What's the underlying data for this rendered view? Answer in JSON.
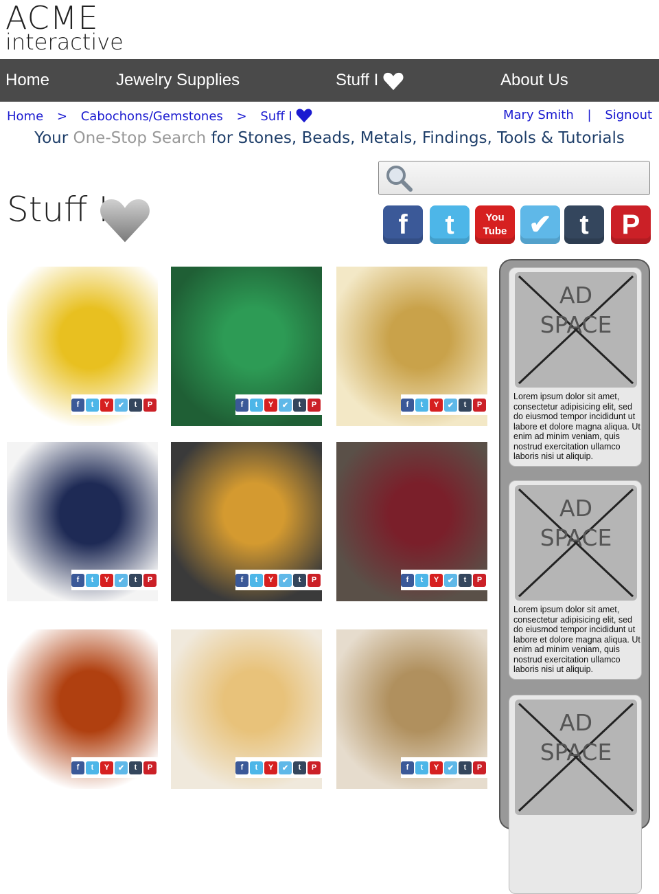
{
  "logo": {
    "line1": "ACME",
    "line2": "interactive"
  },
  "nav": {
    "home": "Home",
    "jewelry": "Jewelry Supplies",
    "stuff": "Stuff I",
    "about": "About Us"
  },
  "breadcrumb": {
    "home": "Home",
    "sep1": ">",
    "category": "Cabochons/Gemstones",
    "sep2": ">",
    "current": "Suff I"
  },
  "user": {
    "name": "Mary Smith",
    "sep": "|",
    "signout": "Signout"
  },
  "tagline": {
    "part1": "Your ",
    "part2": "One-Stop Search",
    "part3": " for Stones, Beads, Metals, Findings, Tools & Tutorials"
  },
  "search": {
    "value": "",
    "placeholder": ""
  },
  "page_title": "Stuff I",
  "social": [
    {
      "name": "facebook-icon",
      "glyph": "f",
      "color": "#3b5998"
    },
    {
      "name": "twitter-icon",
      "glyph": "t",
      "color": "#4db6e8"
    },
    {
      "name": "youtube-icon",
      "glyph": "You Tube",
      "color": "#d62020"
    },
    {
      "name": "foursquare-icon",
      "glyph": "✔",
      "color": "#5fb8e8"
    },
    {
      "name": "tumblr-icon",
      "glyph": "t",
      "color": "#34465d"
    },
    {
      "name": "pinterest-icon",
      "glyph": "P",
      "color": "#cb2027"
    }
  ],
  "tiles": [
    {
      "name": "yellow-gemstones",
      "colors": [
        "#ffffff",
        "#e8c020"
      ]
    },
    {
      "name": "malachite-beads",
      "colors": [
        "#1f5f35",
        "#2d9b55"
      ]
    },
    {
      "name": "gold-wire",
      "colors": [
        "#f3e8c6",
        "#c9a24a"
      ]
    },
    {
      "name": "woman-beading",
      "colors": [
        "#f4f4f4",
        "#1e2a55"
      ]
    },
    {
      "name": "citrine-gem",
      "colors": [
        "#3a3a3a",
        "#d49a30"
      ]
    },
    {
      "name": "woman-jeweler",
      "colors": [
        "#5a5048",
        "#7a1f2a"
      ]
    },
    {
      "name": "assorted-cabochons",
      "colors": [
        "#ffffff",
        "#b04010"
      ]
    },
    {
      "name": "oval-citrines",
      "colors": [
        "#f0e9dc",
        "#e8c27a"
      ]
    },
    {
      "name": "smiling-woman",
      "colors": [
        "#e6dccd",
        "#b0905e"
      ]
    }
  ],
  "ads": [
    {
      "label1": "AD",
      "label2": "SPACE",
      "text": "Lorem ipsum dolor sit amet, consectetur adipisicing elit, sed do  eiusmod tempor incididunt ut labore et dolore magna aliqua. Ut enim ad minim veniam, quis nostrud exercitation ullamco laboris nisi ut aliquip."
    },
    {
      "label1": "AD",
      "label2": "SPACE",
      "text": "Lorem ipsum dolor sit amet, consectetur adipisicing elit, sed do  eiusmod tempor incididunt ut labore et dolore magna aliqua. Ut enim ad minim veniam, quis nostrud exercitation ullamco laboris nisi ut aliquip."
    },
    {
      "label1": "AD",
      "label2": "SPACE",
      "text": ""
    }
  ]
}
